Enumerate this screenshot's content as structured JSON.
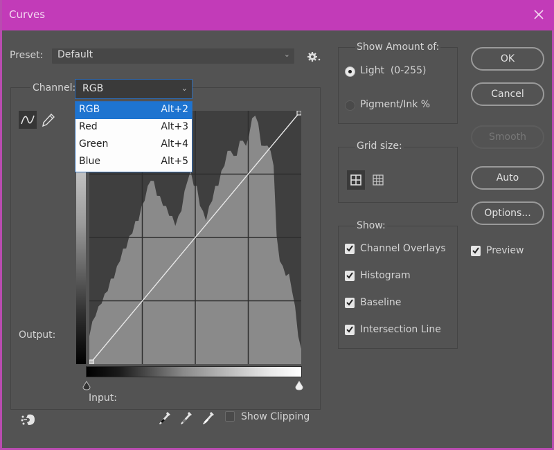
{
  "window": {
    "title": "Curves",
    "accent_color": "#c23bb8",
    "close_icon": "close-icon"
  },
  "preset": {
    "label": "Preset:",
    "value": "Default",
    "options_icon": "gear-icon"
  },
  "channel": {
    "label": "Channel:",
    "value": "RGB",
    "dropdown_open": true,
    "options": [
      {
        "name": "RGB",
        "shortcut": "Alt+2",
        "selected": true
      },
      {
        "name": "Red",
        "shortcut": "Alt+3",
        "selected": false
      },
      {
        "name": "Green",
        "shortcut": "Alt+4",
        "selected": false
      },
      {
        "name": "Blue",
        "shortcut": "Alt+5",
        "selected": false
      }
    ],
    "selection_color": "#1e74d0"
  },
  "tools": {
    "curve_tool": "curve-point-icon",
    "pencil_tool": "pencil-icon",
    "active": "curve"
  },
  "graph": {
    "output_label": "Output:",
    "input_label": "Input:",
    "grid_divisions": 4,
    "curve_points": [
      [
        0,
        0
      ],
      [
        255,
        255
      ]
    ],
    "histogram_profile": [
      0.12,
      0.16,
      0.2,
      0.22,
      0.25,
      0.27,
      0.3,
      0.33,
      0.35,
      0.38,
      0.42,
      0.45,
      0.47,
      0.5,
      0.53,
      0.56,
      0.58,
      0.62,
      0.66,
      0.7,
      0.74,
      0.72,
      0.68,
      0.66,
      0.64,
      0.62,
      0.6,
      0.58,
      0.56,
      0.58,
      0.62,
      0.68,
      0.74,
      0.76,
      0.72,
      0.7,
      0.64,
      0.6,
      0.58,
      0.62,
      0.66,
      0.7,
      0.72,
      0.76,
      0.8,
      0.84,
      0.86,
      0.82,
      0.84,
      0.88,
      0.9,
      0.86,
      0.92,
      0.97,
      1.0,
      0.95,
      0.88,
      0.86,
      0.88,
      0.84,
      0.8,
      0.5,
      0.42,
      0.38,
      0.36,
      0.35,
      0.3,
      0.22,
      0.12,
      0.05
    ]
  },
  "bottom": {
    "auto_target_icon": "hand-target-icon",
    "eyedroppers": [
      "black-point-eyedropper-icon",
      "gray-point-eyedropper-icon",
      "white-point-eyedropper-icon"
    ],
    "show_clipping_label": "Show Clipping",
    "show_clipping_checked": false
  },
  "show_amount": {
    "title": "Show Amount of:",
    "options": [
      {
        "label": "Light  (0-255)",
        "selected": true
      },
      {
        "label": "Pigment/Ink %",
        "selected": false
      }
    ]
  },
  "grid_size": {
    "title": "Grid size:",
    "options": [
      "simple-grid-icon",
      "detailed-grid-icon"
    ],
    "selected": "simple"
  },
  "show": {
    "title": "Show:",
    "items": [
      {
        "label": "Channel Overlays",
        "checked": true
      },
      {
        "label": "Histogram",
        "checked": true
      },
      {
        "label": "Baseline",
        "checked": true
      },
      {
        "label": "Intersection Line",
        "checked": true
      }
    ]
  },
  "buttons": {
    "ok": "OK",
    "cancel": "Cancel",
    "smooth": "Smooth",
    "auto": "Auto",
    "options": "Options..."
  },
  "preview": {
    "label": "Preview",
    "checked": true
  }
}
